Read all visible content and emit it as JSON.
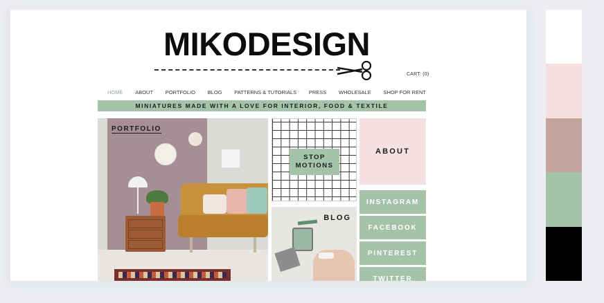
{
  "site": {
    "logo": "MIKODESIGN",
    "cart": "CART: (0)"
  },
  "nav": {
    "items": [
      "HOME",
      "ABOUT",
      "PORTFOLIO",
      "BLOG",
      "PATTERNS & TUTORIALS",
      "PRESS",
      "WHOLESALE",
      "SHOP FOR RENT"
    ],
    "active": "HOME"
  },
  "banner": {
    "text": "MINIATURES MADE WITH A LOVE FOR INTERIOR, FOOD & TEXTILE"
  },
  "tiles": {
    "portfolio": "PORTFOLIO",
    "stop_motions_line1": "STOP",
    "stop_motions_line2": "MOTIONS",
    "about": "ABOUT",
    "blog": "BLOG",
    "instagram": "INSTAGRAM",
    "facebook": "FACEBOOK",
    "pinterest": "PINTEREST",
    "twitter": "TWITTER"
  },
  "palette": {
    "swatches": [
      "#ffffff",
      "#f5e1e1",
      "#c4a49d",
      "#a4c3a8",
      "#000000"
    ]
  },
  "colors": {
    "accent_green": "#a4c3a8",
    "accent_pink": "#f5e1e1"
  }
}
